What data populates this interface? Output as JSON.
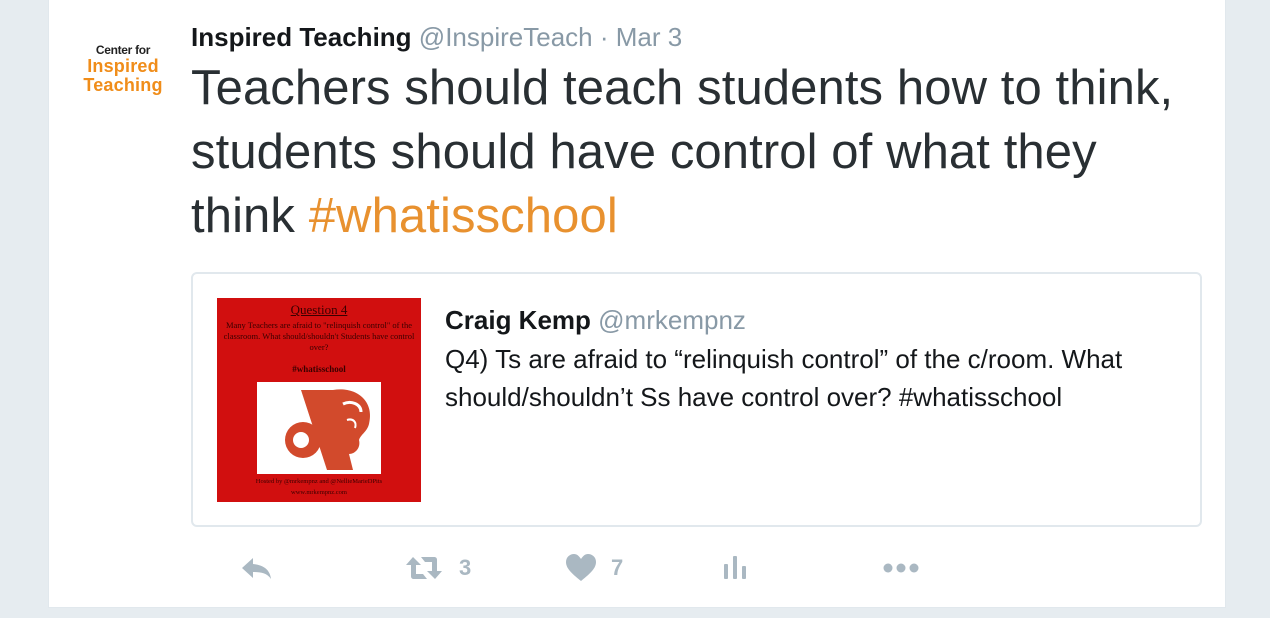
{
  "tweet": {
    "avatar": {
      "line1": "Center for",
      "line2": "Inspired",
      "line3": "Teaching",
      "accent": "#f08d1a"
    },
    "author_name": "Inspired Teaching",
    "handle": "@InspireTeach",
    "separator": "·",
    "date": "Mar 3",
    "text": "Teachers should teach students how to think, students should have control of what they think",
    "hashtag": "#whatisschool",
    "hashtag_color": "#e8912f"
  },
  "quoted": {
    "image": {
      "title": "Question 4",
      "body": "Many Teachers are afraid to \"relinquish control\" of the classroom. What should/shouldn't Students have control over?",
      "tag": "#whatisschool",
      "footer1": "Hosted by @mrkempnz and @NellieMarieDPits",
      "footer2": "www.mrkempnz.com",
      "background": "#d10f0f"
    },
    "author_name": "Craig Kemp",
    "handle": "@mrkempnz",
    "text": "Q4) Ts are afraid to “relinquish control” of the c/room. What should/shouldn’t Ss have control over? #whatisschool"
  },
  "actions": {
    "reply_icon": "reply-icon",
    "retweet_icon": "retweet-icon",
    "retweet_count": "3",
    "like_icon": "heart-icon",
    "like_count": "7",
    "analytics_icon": "analytics-icon",
    "more_icon": "more-icon",
    "icon_color": "#aab8c2"
  }
}
